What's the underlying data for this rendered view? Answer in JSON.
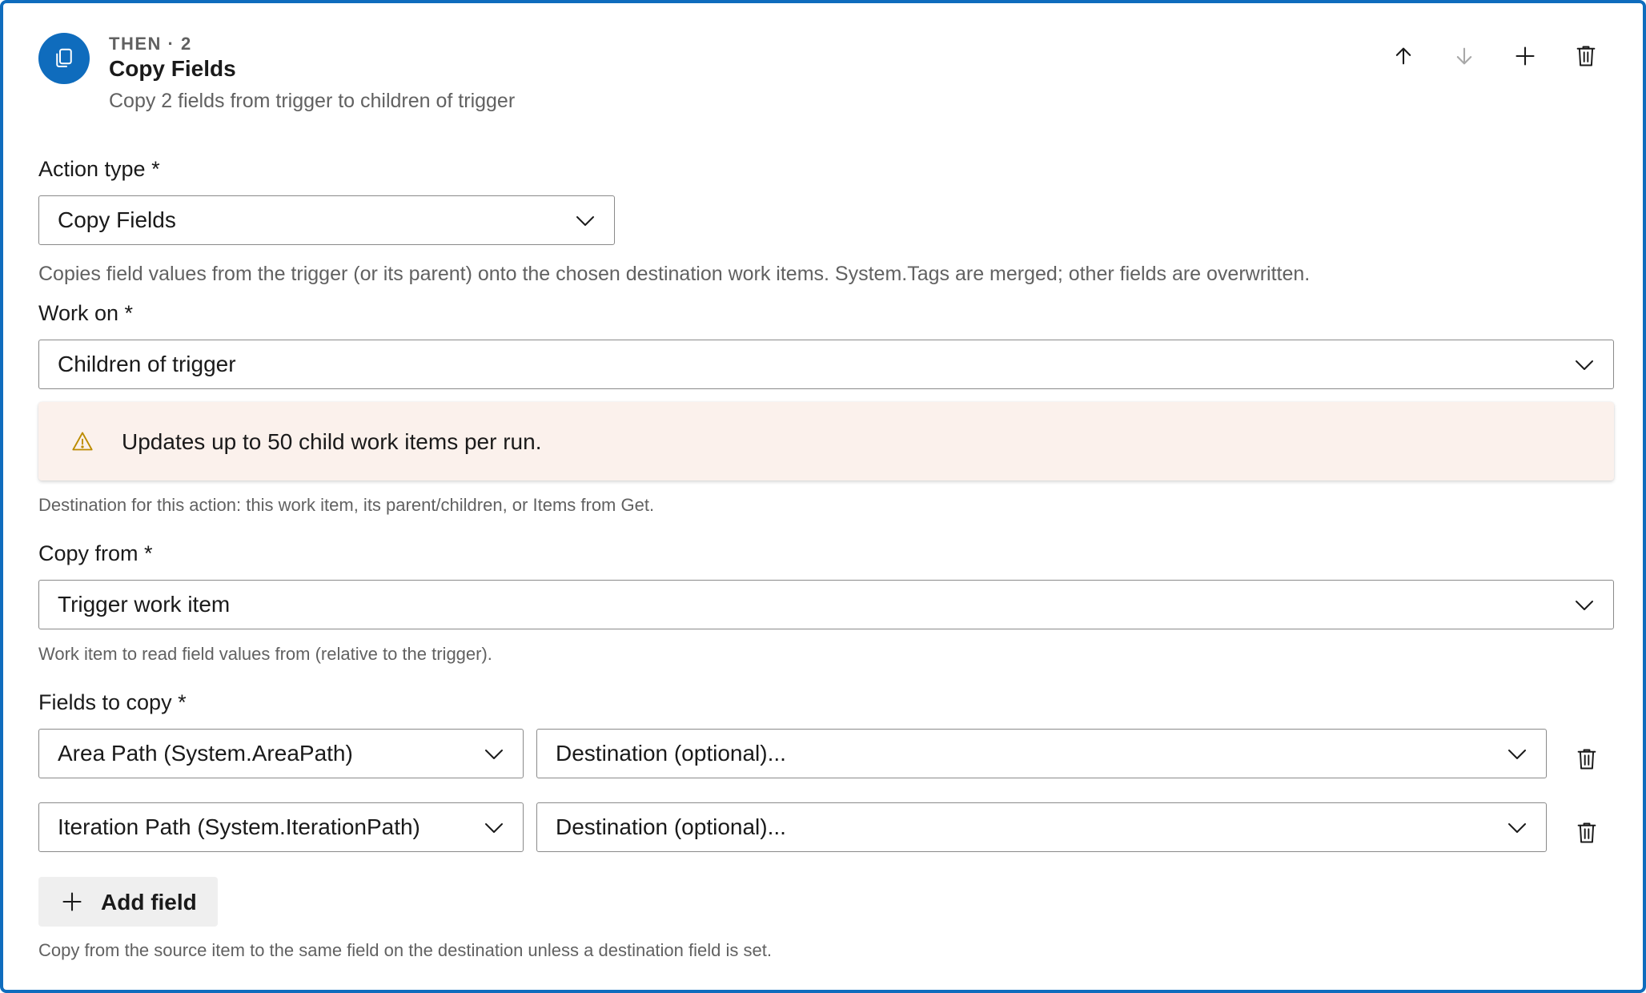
{
  "header": {
    "icon": "copy-icon",
    "step_tag": "THEN · 2",
    "title": "Copy Fields",
    "summary": "Copy 2 fields from trigger to children of trigger",
    "actions": [
      "arrow-up-icon",
      "arrow-down-icon",
      "plus-icon",
      "trash-icon"
    ]
  },
  "action_type": {
    "label": "Action type *",
    "value": "Copy Fields",
    "help": "Copies field values from the trigger (or its parent) onto the chosen destination work items. System.Tags are merged; other fields are overwritten."
  },
  "work_on": {
    "label": "Work on *",
    "value": "Children of trigger",
    "warning": "Updates up to 50 child work items per run.",
    "help": "Destination for this action: this work item, its parent/children, or Items from Get."
  },
  "copy_from": {
    "label": "Copy from *",
    "value": "Trigger work item",
    "help": "Work item to read field values from (relative to the trigger)."
  },
  "fields": {
    "label": "Fields to copy *",
    "rows": [
      {
        "source": "Area Path (System.AreaPath)",
        "destination_placeholder": "Destination (optional)..."
      },
      {
        "source": "Iteration Path (System.IterationPath)",
        "destination_placeholder": "Destination (optional)..."
      }
    ],
    "add_label": "Add field",
    "help": "Copy from the source item to the same field on the destination unless a destination field is set."
  },
  "colors": {
    "accent": "#0f6cbd",
    "warning_bg": "#fbf1ec",
    "warning_icon": "#bc8b00"
  }
}
